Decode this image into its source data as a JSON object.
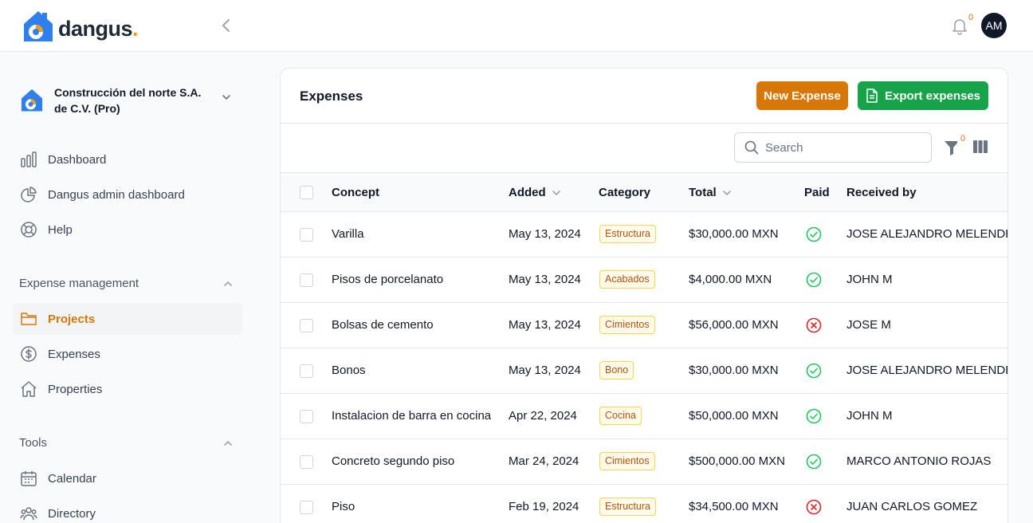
{
  "brand": {
    "name": "dangus",
    "dot": "."
  },
  "header": {
    "notifications_count": "0",
    "avatar_initials": "AM"
  },
  "sidebar": {
    "org_name": "Construcción del norte S.A. de C.V. (Pro)",
    "nav": [
      {
        "label": "Dashboard",
        "icon": "chart-bar-icon"
      },
      {
        "label": "Dangus admin dashboard",
        "icon": "chart-pie-icon"
      },
      {
        "label": "Help",
        "icon": "lifebuoy-icon"
      }
    ],
    "sections": [
      {
        "title": "Expense management",
        "items": [
          {
            "label": "Projects",
            "icon": "folder-icon",
            "active": true
          },
          {
            "label": "Expenses",
            "icon": "dollar-circle-icon"
          },
          {
            "label": "Properties",
            "icon": "home-icon"
          }
        ]
      },
      {
        "title": "Tools",
        "items": [
          {
            "label": "Calendar",
            "icon": "calendar-icon"
          },
          {
            "label": "Directory",
            "icon": "users-icon"
          }
        ]
      }
    ]
  },
  "main": {
    "title": "Expenses",
    "new_button": "New Expense",
    "export_button": "Export expenses",
    "search_placeholder": "Search",
    "filter_count": "0",
    "columns": [
      "Concept",
      "Added",
      "Category",
      "Total",
      "Paid",
      "Received by"
    ],
    "rows": [
      {
        "concept": "Varilla",
        "added": "May 13, 2024",
        "category": "Estructura",
        "total": "$30,000.00 MXN",
        "paid": true,
        "received_by": "JOSE ALEJANDRO MELENDEZ"
      },
      {
        "concept": "Pisos de porcelanato",
        "added": "May 13, 2024",
        "category": "Acabados",
        "total": "$4,000.00 MXN",
        "paid": true,
        "received_by": "JOHN M"
      },
      {
        "concept": "Bolsas de cemento",
        "added": "May 13, 2024",
        "category": "Cimientos",
        "total": "$56,000.00 MXN",
        "paid": false,
        "received_by": "JOSE M"
      },
      {
        "concept": "Bonos",
        "added": "May 13, 2024",
        "category": "Bono",
        "total": "$30,000.00 MXN",
        "paid": true,
        "received_by": "JOSE ALEJANDRO MELENDEZ"
      },
      {
        "concept": "Instalacion de barra en cocina",
        "added": "Apr 22, 2024",
        "category": "Cocina",
        "total": "$50,000.00 MXN",
        "paid": true,
        "received_by": "JOHN M"
      },
      {
        "concept": "Concreto segundo piso",
        "added": "Mar 24, 2024",
        "category": "Cimientos",
        "total": "$500,000.00 MXN",
        "paid": true,
        "received_by": "MARCO ANTONIO ROJAS"
      },
      {
        "concept": "Piso",
        "added": "Feb 19, 2024",
        "category": "Estructura",
        "total": "$34,500.00 MXN",
        "paid": false,
        "received_by": "JUAN CARLOS GOMEZ"
      }
    ]
  },
  "colors": {
    "accent": "#d97706",
    "export_green": "#16a34a",
    "paid_green": "#22c55e",
    "unpaid_red": "#dc2626"
  }
}
